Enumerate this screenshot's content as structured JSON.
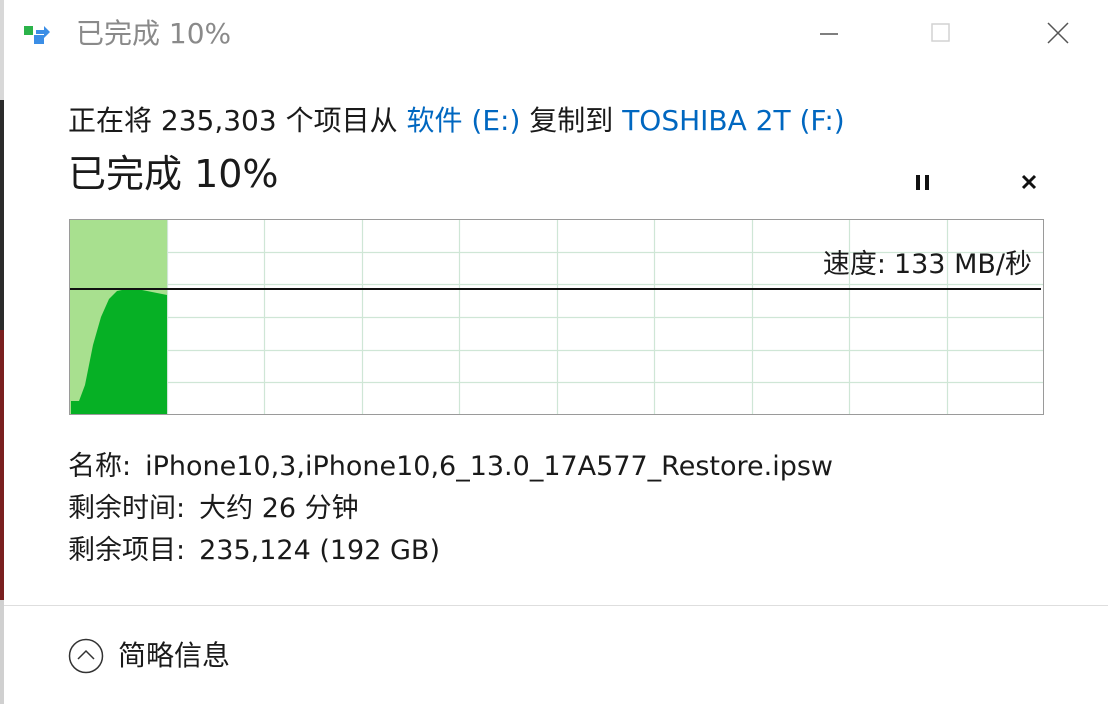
{
  "window": {
    "title": "已完成 10%",
    "minimize_icon": "minimize-icon",
    "maximize_icon": "maximize-icon",
    "close_icon": "close-icon"
  },
  "copy": {
    "prefix": "正在将 235,303 个项目从 ",
    "source": "软件 (E:)",
    "middle": " 复制到 ",
    "destination": "TOSHIBA 2T (F:)",
    "progress_title": "已完成 10%",
    "percent_complete": 10,
    "pause_icon": "pause-icon",
    "cancel_icon": "close-icon"
  },
  "speed": {
    "label": "速度:",
    "value": "133 MB/秒"
  },
  "details": {
    "name_label": "名称:",
    "name_value": "iPhone10,3,iPhone10,6_13.0_17A577_Restore.ipsw",
    "time_label": "剩余时间:",
    "time_value": "大约 26 分钟",
    "items_label": "剩余项目:",
    "items_value": "235,124 (192 GB)"
  },
  "footer": {
    "toggle_label": "简略信息",
    "toggle_icon": "chevron-up-icon"
  },
  "colors": {
    "accent_link": "#0067c0",
    "progress_fill": "#a8e08f",
    "speed_fill": "#06b025",
    "grid": "#cfe6d6"
  }
}
